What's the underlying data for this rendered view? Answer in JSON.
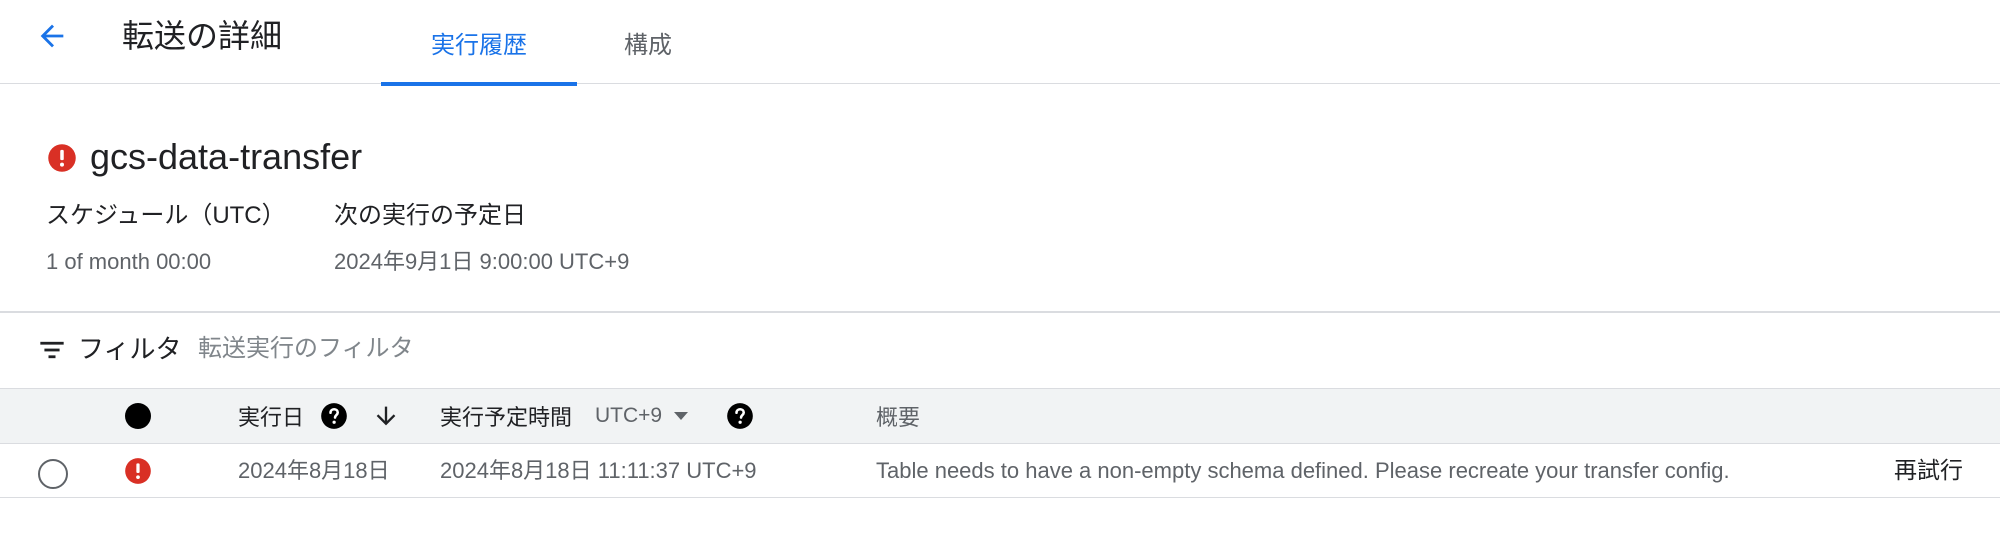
{
  "header": {
    "title": "転送の詳細",
    "tabs": [
      {
        "label": "実行履歴",
        "active": true
      },
      {
        "label": "構成",
        "active": false
      }
    ]
  },
  "job": {
    "name": "gcs-data-transfer",
    "status": "error",
    "schedule_label": "スケジュール（UTC）",
    "schedule_value": "1 of month 00:00",
    "next_run_label": "次の実行の予定日",
    "next_run_value": "2024年9月1日 9:00:00 UTC+9"
  },
  "filter": {
    "label": "フィルタ",
    "placeholder": "転送実行のフィルタ"
  },
  "table": {
    "columns": {
      "run_date": "実行日",
      "scheduled_time": "実行予定時間",
      "timezone": "UTC+9",
      "summary": "概要"
    },
    "rows": [
      {
        "status": "error",
        "run_date": "2024年8月18日",
        "scheduled_time": "2024年8月18日 11:11:37 UTC+9",
        "summary": "Table needs to have a non-empty schema defined. Please recreate your transfer config.",
        "action": "再試行"
      }
    ]
  },
  "colors": {
    "accent": "#1a73e8",
    "error": "#d93025",
    "border": "#dadce0",
    "header_bg": "#f1f3f4"
  },
  "icons": [
    "arrow-back-icon",
    "error-icon",
    "filter-list-icon",
    "status-dot-icon",
    "help-icon",
    "arrow-downward-icon",
    "dropdown-triangle-icon",
    "radio-unchecked-icon"
  ]
}
